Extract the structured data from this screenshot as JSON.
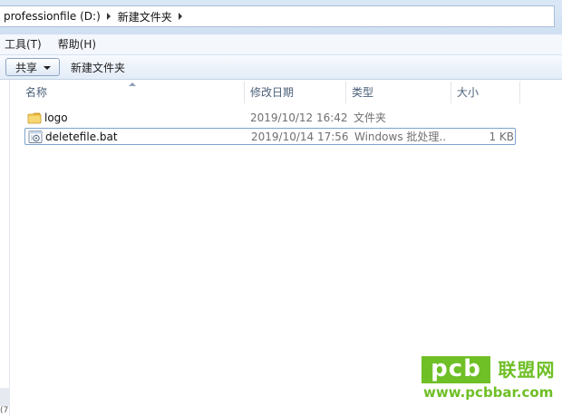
{
  "address_bar": {
    "crumbs": [
      "professionfile (D:)",
      "新建文件夹"
    ]
  },
  "menu": {
    "items": [
      "工具(T)",
      "帮助(H)"
    ]
  },
  "toolbar": {
    "share_label": "共享",
    "new_folder_label": "新建文件夹"
  },
  "columns": {
    "name": "名称",
    "date": "修改日期",
    "type": "类型",
    "size": "大小"
  },
  "files": [
    {
      "name": "logo",
      "date": "2019/10/12 16:42",
      "type": "文件夹",
      "size": "",
      "icon": "folder-icon",
      "selected": false
    },
    {
      "name": "deletefile.bat",
      "date": "2019/10/14 17:56",
      "type": "Windows 批处理...",
      "size": "1 KB",
      "icon": "batch-file-icon",
      "selected": true
    }
  ],
  "status_bar": {
    "fragment": "(7"
  },
  "watermark": {
    "brand": "pcb",
    "brand_cn": "联盟网",
    "url": "www.pcbbar.com",
    "color": "#6fbf26"
  }
}
